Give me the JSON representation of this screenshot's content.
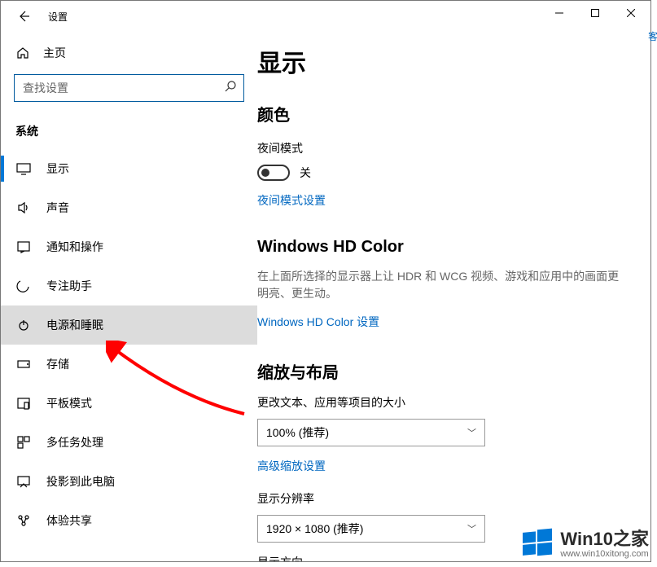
{
  "titlebar": {
    "title": "设置"
  },
  "sidebar": {
    "home_label": "主页",
    "search_placeholder": "查找设置",
    "category_label": "系统",
    "items": [
      {
        "label": "显示"
      },
      {
        "label": "声音"
      },
      {
        "label": "通知和操作"
      },
      {
        "label": "专注助手"
      },
      {
        "label": "电源和睡眠"
      },
      {
        "label": "存储"
      },
      {
        "label": "平板模式"
      },
      {
        "label": "多任务处理"
      },
      {
        "label": "投影到此电脑"
      },
      {
        "label": "体验共享"
      }
    ]
  },
  "content": {
    "page_title": "显示",
    "color": {
      "heading": "颜色",
      "night_label": "夜间模式",
      "toggle_state": "关",
      "link": "夜间模式设置"
    },
    "hd": {
      "heading": "Windows HD Color",
      "desc": "在上面所选择的显示器上让 HDR 和 WCG 视频、游戏和应用中的画面更明亮、更生动。",
      "link": "Windows HD Color 设置"
    },
    "scale": {
      "heading": "缩放与布局",
      "scale_label": "更改文本、应用等项目的大小",
      "scale_value": "100% (推荐)",
      "adv_link": "高级缩放设置",
      "res_label": "显示分辨率",
      "res_value": "1920 × 1080 (推荐)",
      "orient_label": "显示方向"
    }
  },
  "watermark": {
    "title": "Win10之家",
    "url": "www.win10xitong.com"
  },
  "edge_char": "客"
}
